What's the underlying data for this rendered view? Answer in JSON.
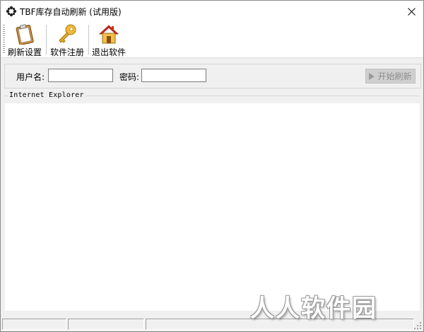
{
  "window": {
    "title": "TBF库存自动刷新 (试用版)"
  },
  "toolbar": {
    "buttons": [
      {
        "label": "刷新设置",
        "icon": "clipboard-icon"
      },
      {
        "label": "软件注册",
        "icon": "key-icon"
      },
      {
        "label": "退出软件",
        "icon": "home-icon"
      }
    ]
  },
  "login": {
    "username_label": "用户名:",
    "username_value": "",
    "password_label": "密码:",
    "password_value": "",
    "start_label": "开始刷新",
    "start_enabled": false
  },
  "browser": {
    "group_label": "Internet Explorer"
  },
  "statusbar": {
    "cells": [
      "",
      "",
      ""
    ]
  },
  "watermark": "人人软件园"
}
